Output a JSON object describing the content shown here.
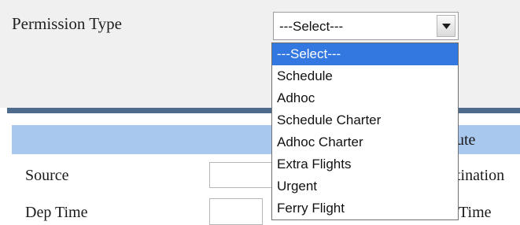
{
  "form": {
    "permission_label": "Permission Type",
    "select_value": "---Select---",
    "options": [
      "---Select---",
      "Schedule",
      "Adhoc",
      "Schedule Charter",
      "Adhoc Charter",
      "Extra Flights",
      "Urgent",
      "Ferry Flight"
    ],
    "selected_index": 0
  },
  "section": {
    "header_partial": "ute"
  },
  "fields": {
    "source_label": "Source",
    "destination_label_partial": "tination",
    "dep_time_label": "Dep Time",
    "arr_time_label_partial": "Time"
  },
  "colors": {
    "divider": "#4e6a8c",
    "header_bar": "#a9c8ee",
    "option_highlight": "#3377e0"
  },
  "icons": {
    "select_arrow": "chevron-down-icon"
  }
}
